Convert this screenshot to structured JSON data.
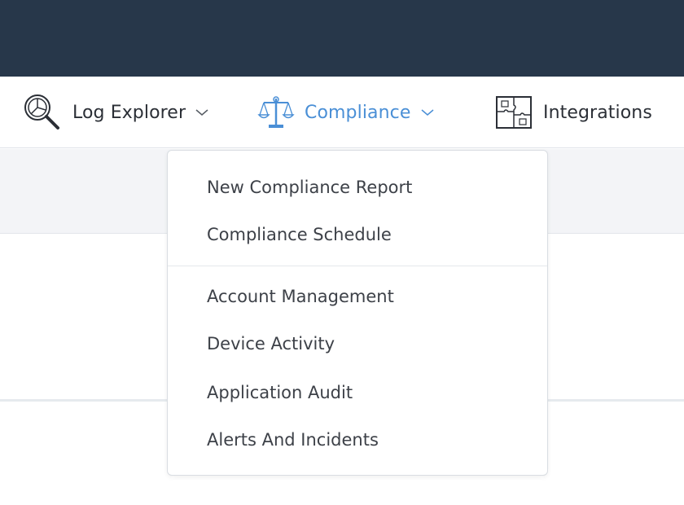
{
  "nav": {
    "items": [
      {
        "label": "Log Explorer",
        "icon": "log-explorer-icon",
        "has_dropdown": true,
        "active": false
      },
      {
        "label": "Compliance",
        "icon": "compliance-scales-icon",
        "has_dropdown": true,
        "active": true
      },
      {
        "label": "Integrations",
        "icon": "integrations-puzzle-icon",
        "has_dropdown": false,
        "active": false
      }
    ]
  },
  "dropdown": {
    "group1": [
      "New Compliance Report",
      "Compliance Schedule"
    ],
    "group2": [
      "Account Management",
      "Device Activity",
      "Application Audit",
      "Alerts And Incidents"
    ]
  },
  "colors": {
    "topbar": "#27374a",
    "active": "#4a8fd6",
    "text": "#2b2f36",
    "subbar": "#f3f4f7"
  }
}
